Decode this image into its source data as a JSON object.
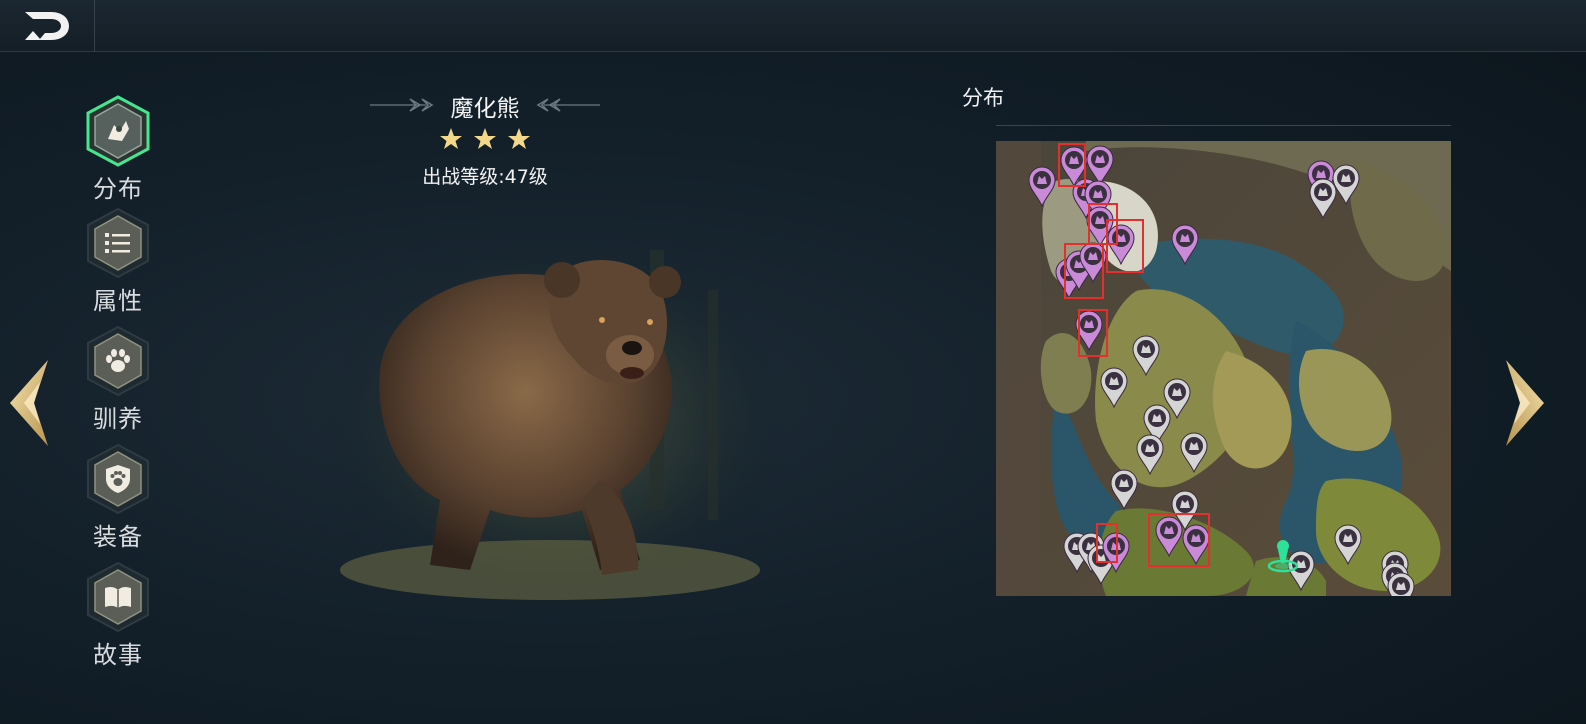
{
  "topbar": {
    "back_icon": "back-arrow-icon"
  },
  "sidebar": {
    "items": [
      {
        "label": "分布",
        "icon": "map-pin-icon",
        "active": true
      },
      {
        "label": "属性",
        "icon": "list-icon",
        "active": false
      },
      {
        "label": "驯养",
        "icon": "paw-icon",
        "active": false
      },
      {
        "label": "装备",
        "icon": "shield-paw-icon",
        "active": false
      },
      {
        "label": "故事",
        "icon": "book-icon",
        "active": false
      }
    ]
  },
  "creature": {
    "name": "魔化熊",
    "stars": 3,
    "level_text": "出战等级:47级"
  },
  "distribution": {
    "title": "分布"
  },
  "colors": {
    "accent_gold": "#d8c08a",
    "active_glow": "#3fe08a",
    "marker_purple": "#c98ad8",
    "marker_gray": "#d5d5d5",
    "highlight_red": "#e3302e",
    "player_green": "#2fe09a"
  }
}
